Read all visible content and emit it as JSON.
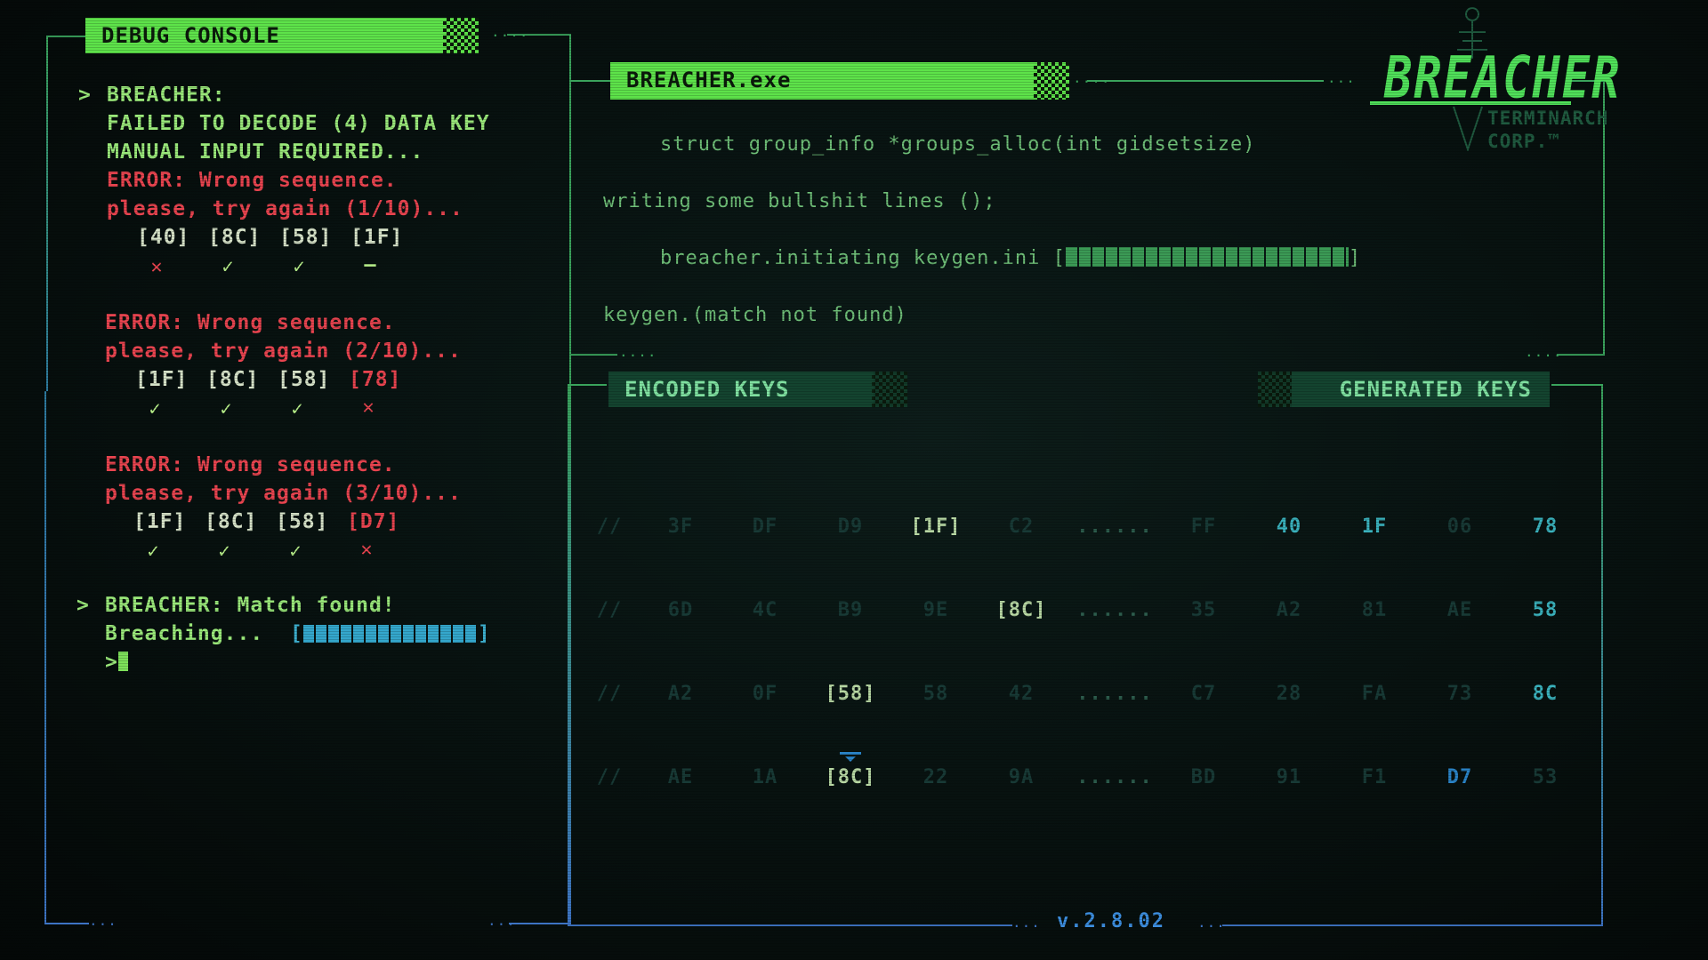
{
  "debug_console": {
    "title": "DEBUG CONSOLE",
    "lines": [
      {
        "prompt": ">",
        "text": "BREACHER:"
      },
      {
        "text": "FAILED TO DECODE (4) DATA KEY"
      },
      {
        "text": "MANUAL INPUT REQUIRED..."
      }
    ],
    "attempts": [
      {
        "error": "ERROR: Wrong sequence.",
        "retry": "please, try again (1/10)...",
        "keys": [
          "[40]",
          "[8C]",
          "[58]",
          "[1F]"
        ],
        "marks": [
          "✕",
          "✓",
          "✓",
          "–"
        ]
      },
      {
        "error": "ERROR: Wrong sequence.",
        "retry": "please, try again (2/10)...",
        "keys": [
          "[1F]",
          "[8C]",
          "[58]",
          "[78]"
        ],
        "marks": [
          "✓",
          "✓",
          "✓",
          "✕"
        ]
      },
      {
        "error": "ERROR: Wrong sequence.",
        "retry": "please, try again (3/10)...",
        "keys": [
          "[1F]",
          "[8C]",
          "[58]",
          "[D7]"
        ],
        "marks": [
          "✓",
          "✓",
          "✓",
          "✕"
        ]
      }
    ],
    "match_prompt": ">",
    "match_text": "BREACHER: Match found!",
    "breaching_label": "Breaching...",
    "breaching_progress": 1.0,
    "input_prompt": ">"
  },
  "breacher_exe": {
    "title": "BREACHER.exe",
    "code_lines": [
      "struct group_info *groups_alloc(int gidsetsize)",
      "writing some bullshit lines ();",
      "breacher.initiating keygen.ini [",
      "keygen.(match not found)"
    ],
    "keygen_progress": 1.0,
    "bracket_close": "]"
  },
  "logo": {
    "name": "BREACHER",
    "company": "TERMINARCH",
    "company2": "CORP.™"
  },
  "keys_panel": {
    "encoded_title": "ENCODED KEYS",
    "generated_title": "GENERATED KEYS",
    "separator": "......",
    "rows": [
      {
        "prefix": "//",
        "encoded": [
          "3F",
          "DF",
          "D9",
          "[1F]",
          "C2"
        ],
        "generated": [
          "FF",
          "40",
          "1F",
          "06",
          "78"
        ]
      },
      {
        "prefix": "//",
        "encoded": [
          "6D",
          "4C",
          "B9",
          "9E",
          "[8C]"
        ],
        "generated": [
          "35",
          "A2",
          "81",
          "AE",
          "58"
        ]
      },
      {
        "prefix": "//",
        "encoded": [
          "A2",
          "0F",
          "[58]",
          "58",
          "42"
        ],
        "generated": [
          "C7",
          "28",
          "FA",
          "73",
          "8C"
        ]
      },
      {
        "prefix": "//",
        "encoded": [
          "AE",
          "1A",
          "[8C]",
          "22",
          "9A"
        ],
        "generated": [
          "BD",
          "91",
          "F1",
          "D7",
          "53"
        ]
      }
    ]
  },
  "version": "v.2.8.02",
  "colors": {
    "accent": "#5ee34a",
    "error": "#e8444f",
    "frame_green": "#3aa35c",
    "frame_blue": "#3d74c4",
    "cyan": "#3db0cf"
  }
}
